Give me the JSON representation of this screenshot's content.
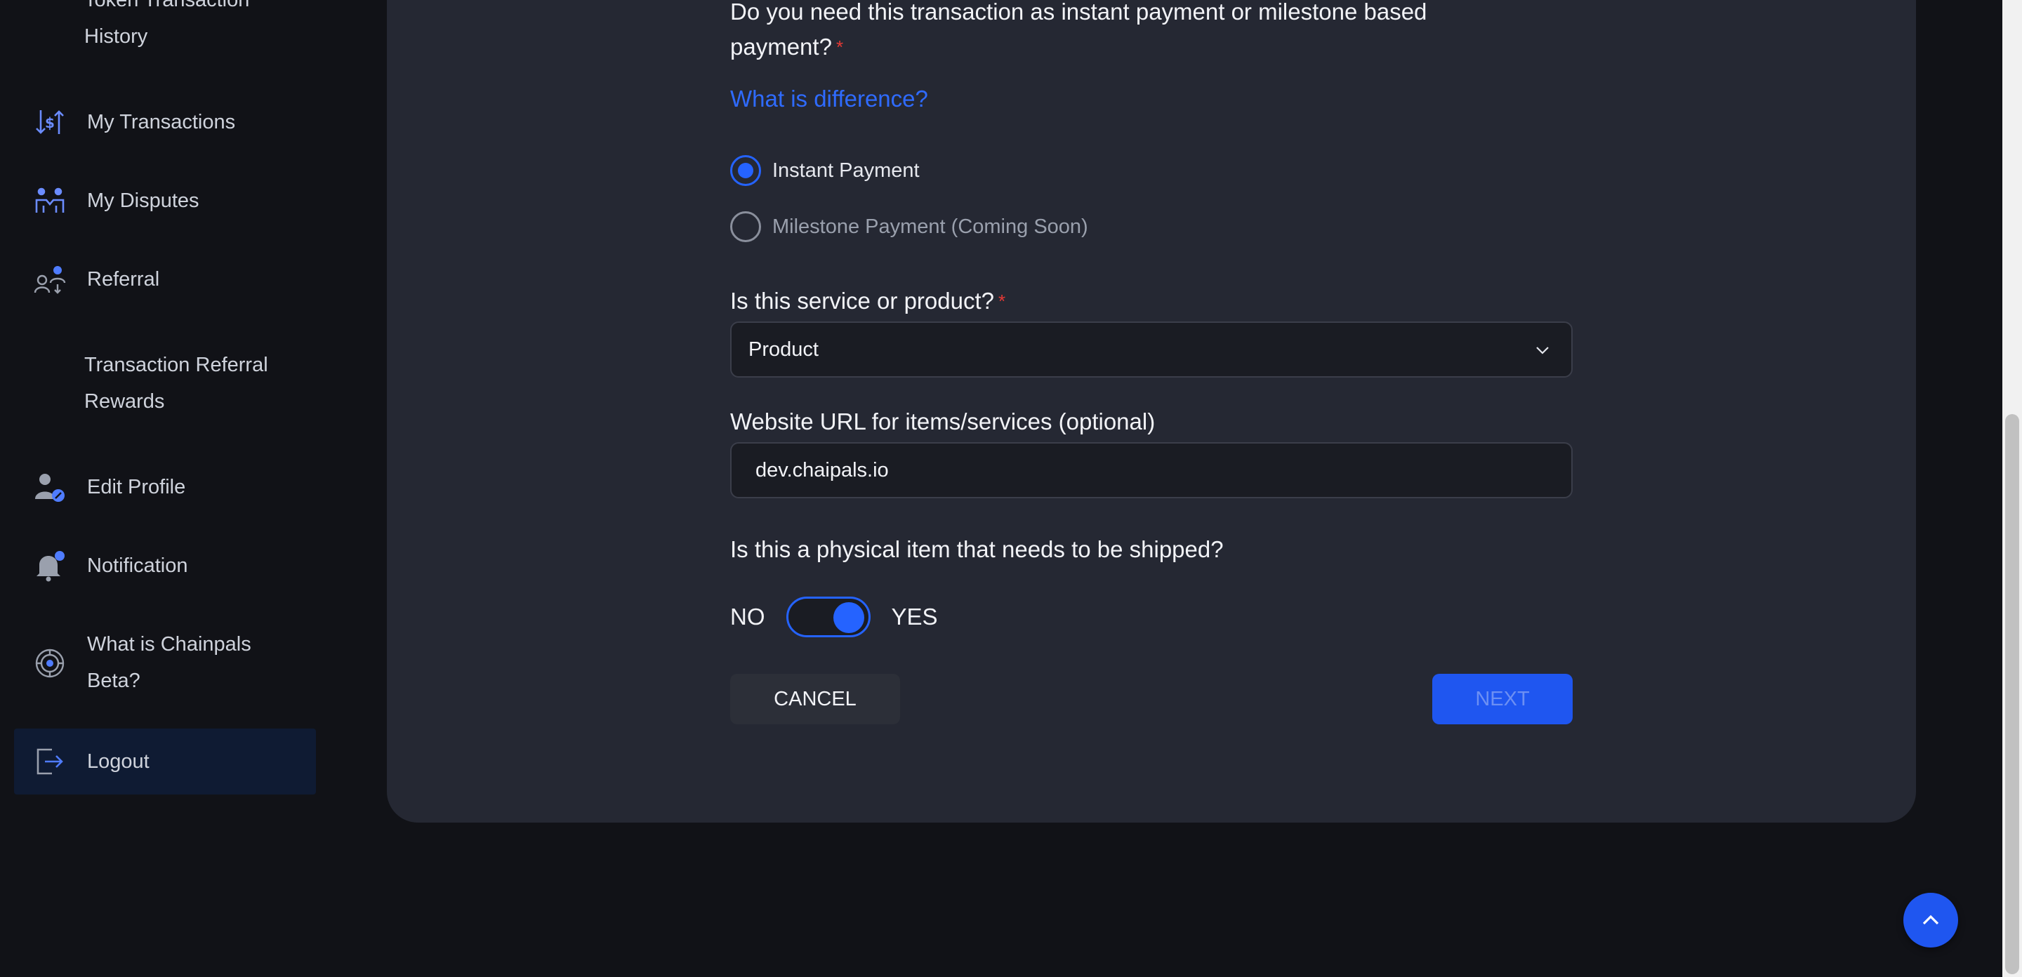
{
  "sidebar": {
    "token_history_partial": "Token Transaction",
    "token_history_label": "History",
    "items": [
      {
        "label": "My Transactions",
        "icon": "dollar-transfer-icon"
      },
      {
        "label": "My Disputes",
        "icon": "handshake-icon"
      },
      {
        "label": "Referral",
        "icon": "referral-icon"
      },
      {
        "label": "Transaction Referral",
        "icon": ""
      },
      {
        "label": "Rewards",
        "icon": ""
      },
      {
        "label": "Edit Profile",
        "icon": "user-edit-icon"
      },
      {
        "label": "Notification",
        "icon": "bell-icon"
      },
      {
        "label": "What is Chainpals",
        "icon": "chainpals-logo-icon"
      },
      {
        "label": "Beta?",
        "icon": ""
      },
      {
        "label": "Logout",
        "icon": "logout-icon"
      }
    ]
  },
  "form": {
    "payment_question_line1": "Do you need this transaction as instant payment or milestone based",
    "payment_question_line2": "payment?",
    "required_mark": "*",
    "difference_link": "What is difference?",
    "payment_options": [
      {
        "label": "Instant Payment",
        "selected": true
      },
      {
        "label": "Milestone Payment (Coming Soon)",
        "selected": false
      }
    ],
    "service_question": "Is this service or product?",
    "service_value": "Product",
    "url_label": "Website URL for items/services (optional)",
    "url_value": "dev.chaipals.io",
    "shipping_question": "Is this a physical item that needs to be shipped?",
    "toggle_no": "NO",
    "toggle_yes": "YES",
    "shipping_toggle_on": true,
    "cancel_label": "CANCEL",
    "next_label": "NEXT"
  },
  "colors": {
    "accent": "#2563ff",
    "background": "#111217",
    "card": "#252833",
    "required": "#e53935"
  }
}
